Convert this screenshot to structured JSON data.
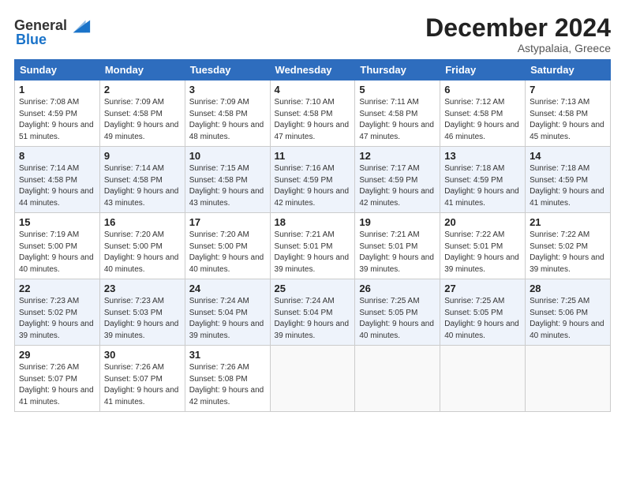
{
  "header": {
    "logo_general": "General",
    "logo_blue": "Blue",
    "month_year": "December 2024",
    "location": "Astypalaia, Greece"
  },
  "weekdays": [
    "Sunday",
    "Monday",
    "Tuesday",
    "Wednesday",
    "Thursday",
    "Friday",
    "Saturday"
  ],
  "weeks": [
    [
      {
        "day": "1",
        "sunrise": "7:08 AM",
        "sunset": "4:59 PM",
        "daylight": "9 hours and 51 minutes."
      },
      {
        "day": "2",
        "sunrise": "7:09 AM",
        "sunset": "4:58 PM",
        "daylight": "9 hours and 49 minutes."
      },
      {
        "day": "3",
        "sunrise": "7:09 AM",
        "sunset": "4:58 PM",
        "daylight": "9 hours and 48 minutes."
      },
      {
        "day": "4",
        "sunrise": "7:10 AM",
        "sunset": "4:58 PM",
        "daylight": "9 hours and 47 minutes."
      },
      {
        "day": "5",
        "sunrise": "7:11 AM",
        "sunset": "4:58 PM",
        "daylight": "9 hours and 47 minutes."
      },
      {
        "day": "6",
        "sunrise": "7:12 AM",
        "sunset": "4:58 PM",
        "daylight": "9 hours and 46 minutes."
      },
      {
        "day": "7",
        "sunrise": "7:13 AM",
        "sunset": "4:58 PM",
        "daylight": "9 hours and 45 minutes."
      }
    ],
    [
      {
        "day": "8",
        "sunrise": "7:14 AM",
        "sunset": "4:58 PM",
        "daylight": "9 hours and 44 minutes."
      },
      {
        "day": "9",
        "sunrise": "7:14 AM",
        "sunset": "4:58 PM",
        "daylight": "9 hours and 43 minutes."
      },
      {
        "day": "10",
        "sunrise": "7:15 AM",
        "sunset": "4:58 PM",
        "daylight": "9 hours and 43 minutes."
      },
      {
        "day": "11",
        "sunrise": "7:16 AM",
        "sunset": "4:59 PM",
        "daylight": "9 hours and 42 minutes."
      },
      {
        "day": "12",
        "sunrise": "7:17 AM",
        "sunset": "4:59 PM",
        "daylight": "9 hours and 42 minutes."
      },
      {
        "day": "13",
        "sunrise": "7:18 AM",
        "sunset": "4:59 PM",
        "daylight": "9 hours and 41 minutes."
      },
      {
        "day": "14",
        "sunrise": "7:18 AM",
        "sunset": "4:59 PM",
        "daylight": "9 hours and 41 minutes."
      }
    ],
    [
      {
        "day": "15",
        "sunrise": "7:19 AM",
        "sunset": "5:00 PM",
        "daylight": "9 hours and 40 minutes."
      },
      {
        "day": "16",
        "sunrise": "7:20 AM",
        "sunset": "5:00 PM",
        "daylight": "9 hours and 40 minutes."
      },
      {
        "day": "17",
        "sunrise": "7:20 AM",
        "sunset": "5:00 PM",
        "daylight": "9 hours and 40 minutes."
      },
      {
        "day": "18",
        "sunrise": "7:21 AM",
        "sunset": "5:01 PM",
        "daylight": "9 hours and 39 minutes."
      },
      {
        "day": "19",
        "sunrise": "7:21 AM",
        "sunset": "5:01 PM",
        "daylight": "9 hours and 39 minutes."
      },
      {
        "day": "20",
        "sunrise": "7:22 AM",
        "sunset": "5:01 PM",
        "daylight": "9 hours and 39 minutes."
      },
      {
        "day": "21",
        "sunrise": "7:22 AM",
        "sunset": "5:02 PM",
        "daylight": "9 hours and 39 minutes."
      }
    ],
    [
      {
        "day": "22",
        "sunrise": "7:23 AM",
        "sunset": "5:02 PM",
        "daylight": "9 hours and 39 minutes."
      },
      {
        "day": "23",
        "sunrise": "7:23 AM",
        "sunset": "5:03 PM",
        "daylight": "9 hours and 39 minutes."
      },
      {
        "day": "24",
        "sunrise": "7:24 AM",
        "sunset": "5:04 PM",
        "daylight": "9 hours and 39 minutes."
      },
      {
        "day": "25",
        "sunrise": "7:24 AM",
        "sunset": "5:04 PM",
        "daylight": "9 hours and 39 minutes."
      },
      {
        "day": "26",
        "sunrise": "7:25 AM",
        "sunset": "5:05 PM",
        "daylight": "9 hours and 40 minutes."
      },
      {
        "day": "27",
        "sunrise": "7:25 AM",
        "sunset": "5:05 PM",
        "daylight": "9 hours and 40 minutes."
      },
      {
        "day": "28",
        "sunrise": "7:25 AM",
        "sunset": "5:06 PM",
        "daylight": "9 hours and 40 minutes."
      }
    ],
    [
      {
        "day": "29",
        "sunrise": "7:26 AM",
        "sunset": "5:07 PM",
        "daylight": "9 hours and 41 minutes."
      },
      {
        "day": "30",
        "sunrise": "7:26 AM",
        "sunset": "5:07 PM",
        "daylight": "9 hours and 41 minutes."
      },
      {
        "day": "31",
        "sunrise": "7:26 AM",
        "sunset": "5:08 PM",
        "daylight": "9 hours and 42 minutes."
      },
      null,
      null,
      null,
      null
    ]
  ]
}
